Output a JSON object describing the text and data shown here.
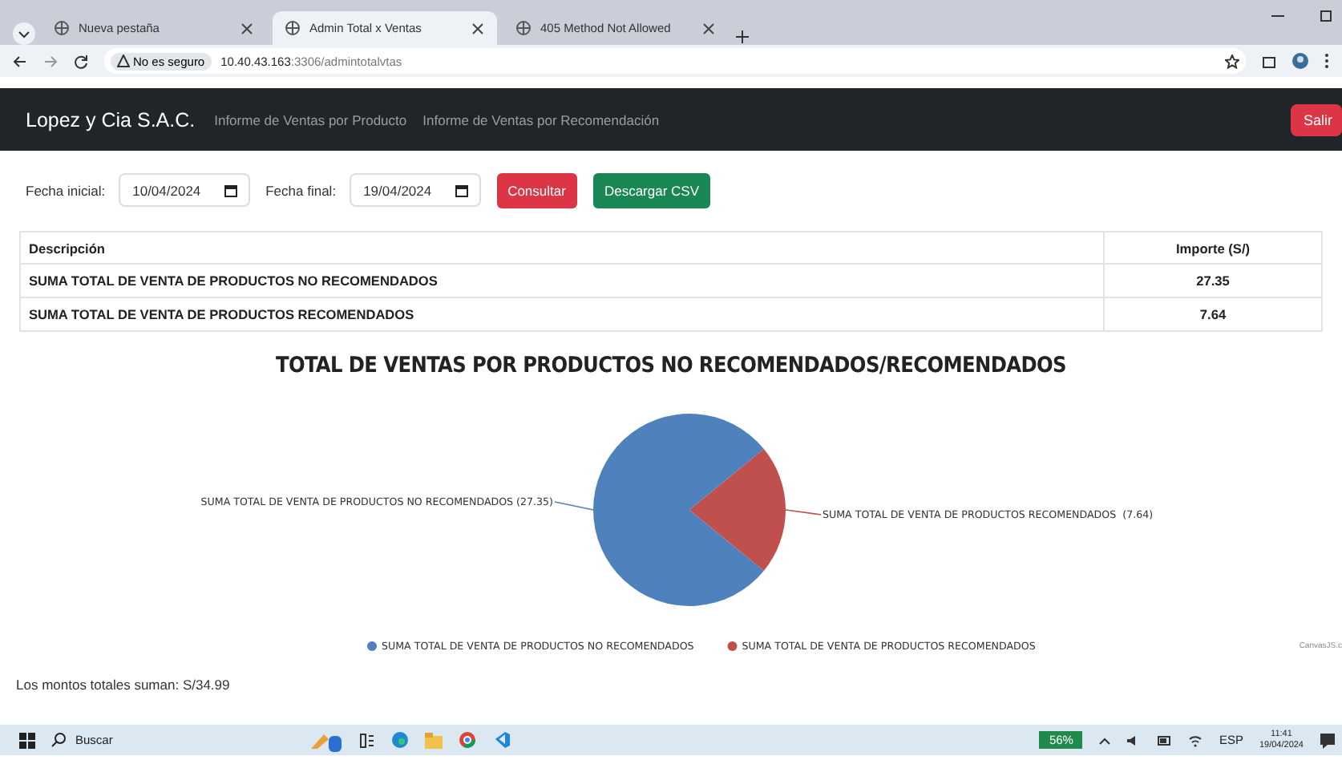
{
  "browser": {
    "tabs": [
      {
        "title": "Nueva pestaña",
        "selected": false
      },
      {
        "title": "Admin Total x Ventas",
        "selected": true
      },
      {
        "title": "405 Method Not Allowed",
        "selected": false
      }
    ],
    "security": "No es seguro",
    "url_host": "10.40.43.163",
    "url_rest": ":3306/admintotalvtas"
  },
  "navbar": {
    "brand": "Lopez y Cia S.A.C.",
    "links": [
      "Informe de Ventas por Producto",
      "Informe de Ventas por Recomendación"
    ],
    "logout": "Salir"
  },
  "filters": {
    "start_label": "Fecha inicial:",
    "start_value": "10/04/2024",
    "end_label": "Fecha final:",
    "end_value": "19/04/2024",
    "buttons": [
      {
        "label": "Consultar",
        "kind": "danger"
      },
      {
        "label": "Descargar CSV",
        "kind": "success"
      }
    ]
  },
  "table": {
    "columns": [
      "Descripción",
      "Importe (S/)"
    ],
    "rows": [
      [
        "SUMA TOTAL DE VENTA DE PRODUCTOS NO RECOMENDADOS",
        "27.35"
      ],
      [
        "SUMA TOTAL DE VENTA DE PRODUCTOS RECOMENDADOS",
        "7.64"
      ]
    ]
  },
  "chart": {
    "credit": "CanvasJS.c",
    "chart_data": {
      "type": "pie",
      "title": "TOTAL DE VENTAS POR PRODUCTOS NO RECOMENDADOS/RECOMENDADOS",
      "categories": [
        "SUMA TOTAL DE VENTA DE PRODUCTOS NO RECOMENDADOS",
        "SUMA TOTAL DE VENTA DE PRODUCTOS RECOMENDADOS"
      ],
      "values": [
        27.35,
        7.64
      ],
      "colors": [
        "#4f81bc",
        "#c0504e"
      ],
      "legend": "bottom",
      "value_labels": [
        "SUMA TOTAL DE VENTA DE PRODUCTOS NO RECOMENDADOS (27.35)",
        "SUMA TOTAL DE VENTA DE PRODUCTOS RECOMENDADOS  (7.64)"
      ]
    }
  },
  "summary": "Los montos totales suman: S/34.99",
  "taskbar": {
    "search": "Buscar",
    "battery": "56%",
    "language": "ESP",
    "time": "11:41",
    "date": "19/04/2024"
  }
}
